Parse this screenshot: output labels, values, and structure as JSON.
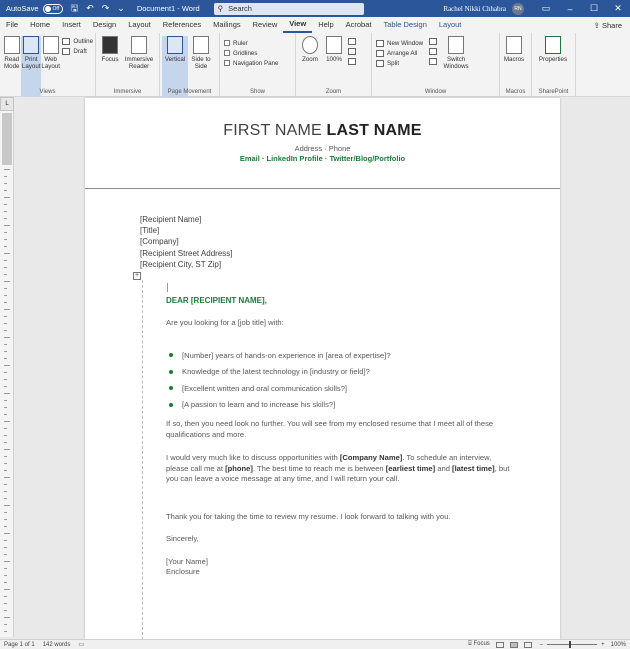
{
  "titlebar": {
    "autosave_label": "AutoSave",
    "autosave_state": "Off",
    "doc_title": "Document1 - Word",
    "search_placeholder": "Search",
    "user_name": "Rachel Nikki Chhabra",
    "user_initials": "RN"
  },
  "menu": {
    "tabs": [
      "File",
      "Home",
      "Insert",
      "Design",
      "Layout",
      "References",
      "Mailings",
      "Review",
      "View",
      "Help",
      "Acrobat",
      "Table Design",
      "Layout"
    ],
    "active_tab": "View",
    "share_label": "Share"
  },
  "ribbon": {
    "views": {
      "read_mode": "Read Mode",
      "print_layout": "Print Layout",
      "web_layout": "Web Layout",
      "outline": "Outline",
      "draft": "Draft",
      "label": "Views"
    },
    "immersive": {
      "focus": "Focus",
      "immersive_reader": "Immersive Reader",
      "label": "Immersive"
    },
    "page_movement": {
      "vertical": "Vertical",
      "side_to_side": "Side to Side",
      "label": "Page Movement"
    },
    "show": {
      "ruler": "Ruler",
      "gridlines": "Gridlines",
      "navigation_pane": "Navigation Pane",
      "label": "Show"
    },
    "zoom": {
      "zoom": "Zoom",
      "hundred": "100%",
      "label": "Zoom"
    },
    "window": {
      "new_window": "New Window",
      "arrange_all": "Arrange All",
      "split": "Split",
      "switch_windows": "Switch Windows",
      "label": "Window"
    },
    "macros": {
      "macros": "Macros",
      "label": "Macros"
    },
    "sharepoint": {
      "properties": "Properties",
      "label": "SharePoint"
    }
  },
  "document": {
    "first_name": "FIRST NAME ",
    "last_name": "LAST NAME",
    "address": "Address · Phone",
    "links": "Email · LinkedIn Profile · Twitter/Blog/Portfolio",
    "recipient": [
      "[Recipient Name]",
      "[Title]",
      "[Company]",
      "[Recipient Street Address]",
      "[Recipient City, ST Zip]"
    ],
    "salutation": "DEAR [RECIPIENT NAME],",
    "intro": "Are you looking for a [job title] with:",
    "bullets": [
      "[Number] years of hands-on experience in [area of expertise]?",
      "Knowledge of the latest technology in [industry or field]?",
      "[Excellent written and oral communication skills?]",
      "[A passion to learn and to increase his skills?]"
    ],
    "para1": "If so, then you need look no further. You will see from my enclosed resume that I meet all of these qualifications and more.",
    "para2_a": "I would very much like to discuss opportunities with ",
    "para2_company": "[Company Name]",
    "para2_b": ". To schedule an interview, please call me at ",
    "para2_phone": "[phone]",
    "para2_c": ". The best time to reach me is between ",
    "para2_earliest": "[earliest time]",
    "para2_d": " and ",
    "para2_latest": "[latest time]",
    "para2_e": ", but you can leave a voice message at any time, and I will return your call.",
    "para3": "Thank you for taking the time to review my resume. I look forward to talking with you.",
    "closing": "Sincerely,",
    "your_name": "[Your Name]",
    "enclosure": "Enclosure"
  },
  "status": {
    "page": "Page 1 of 1",
    "words": "142 words",
    "focus": "Focus",
    "zoom": "100%"
  }
}
